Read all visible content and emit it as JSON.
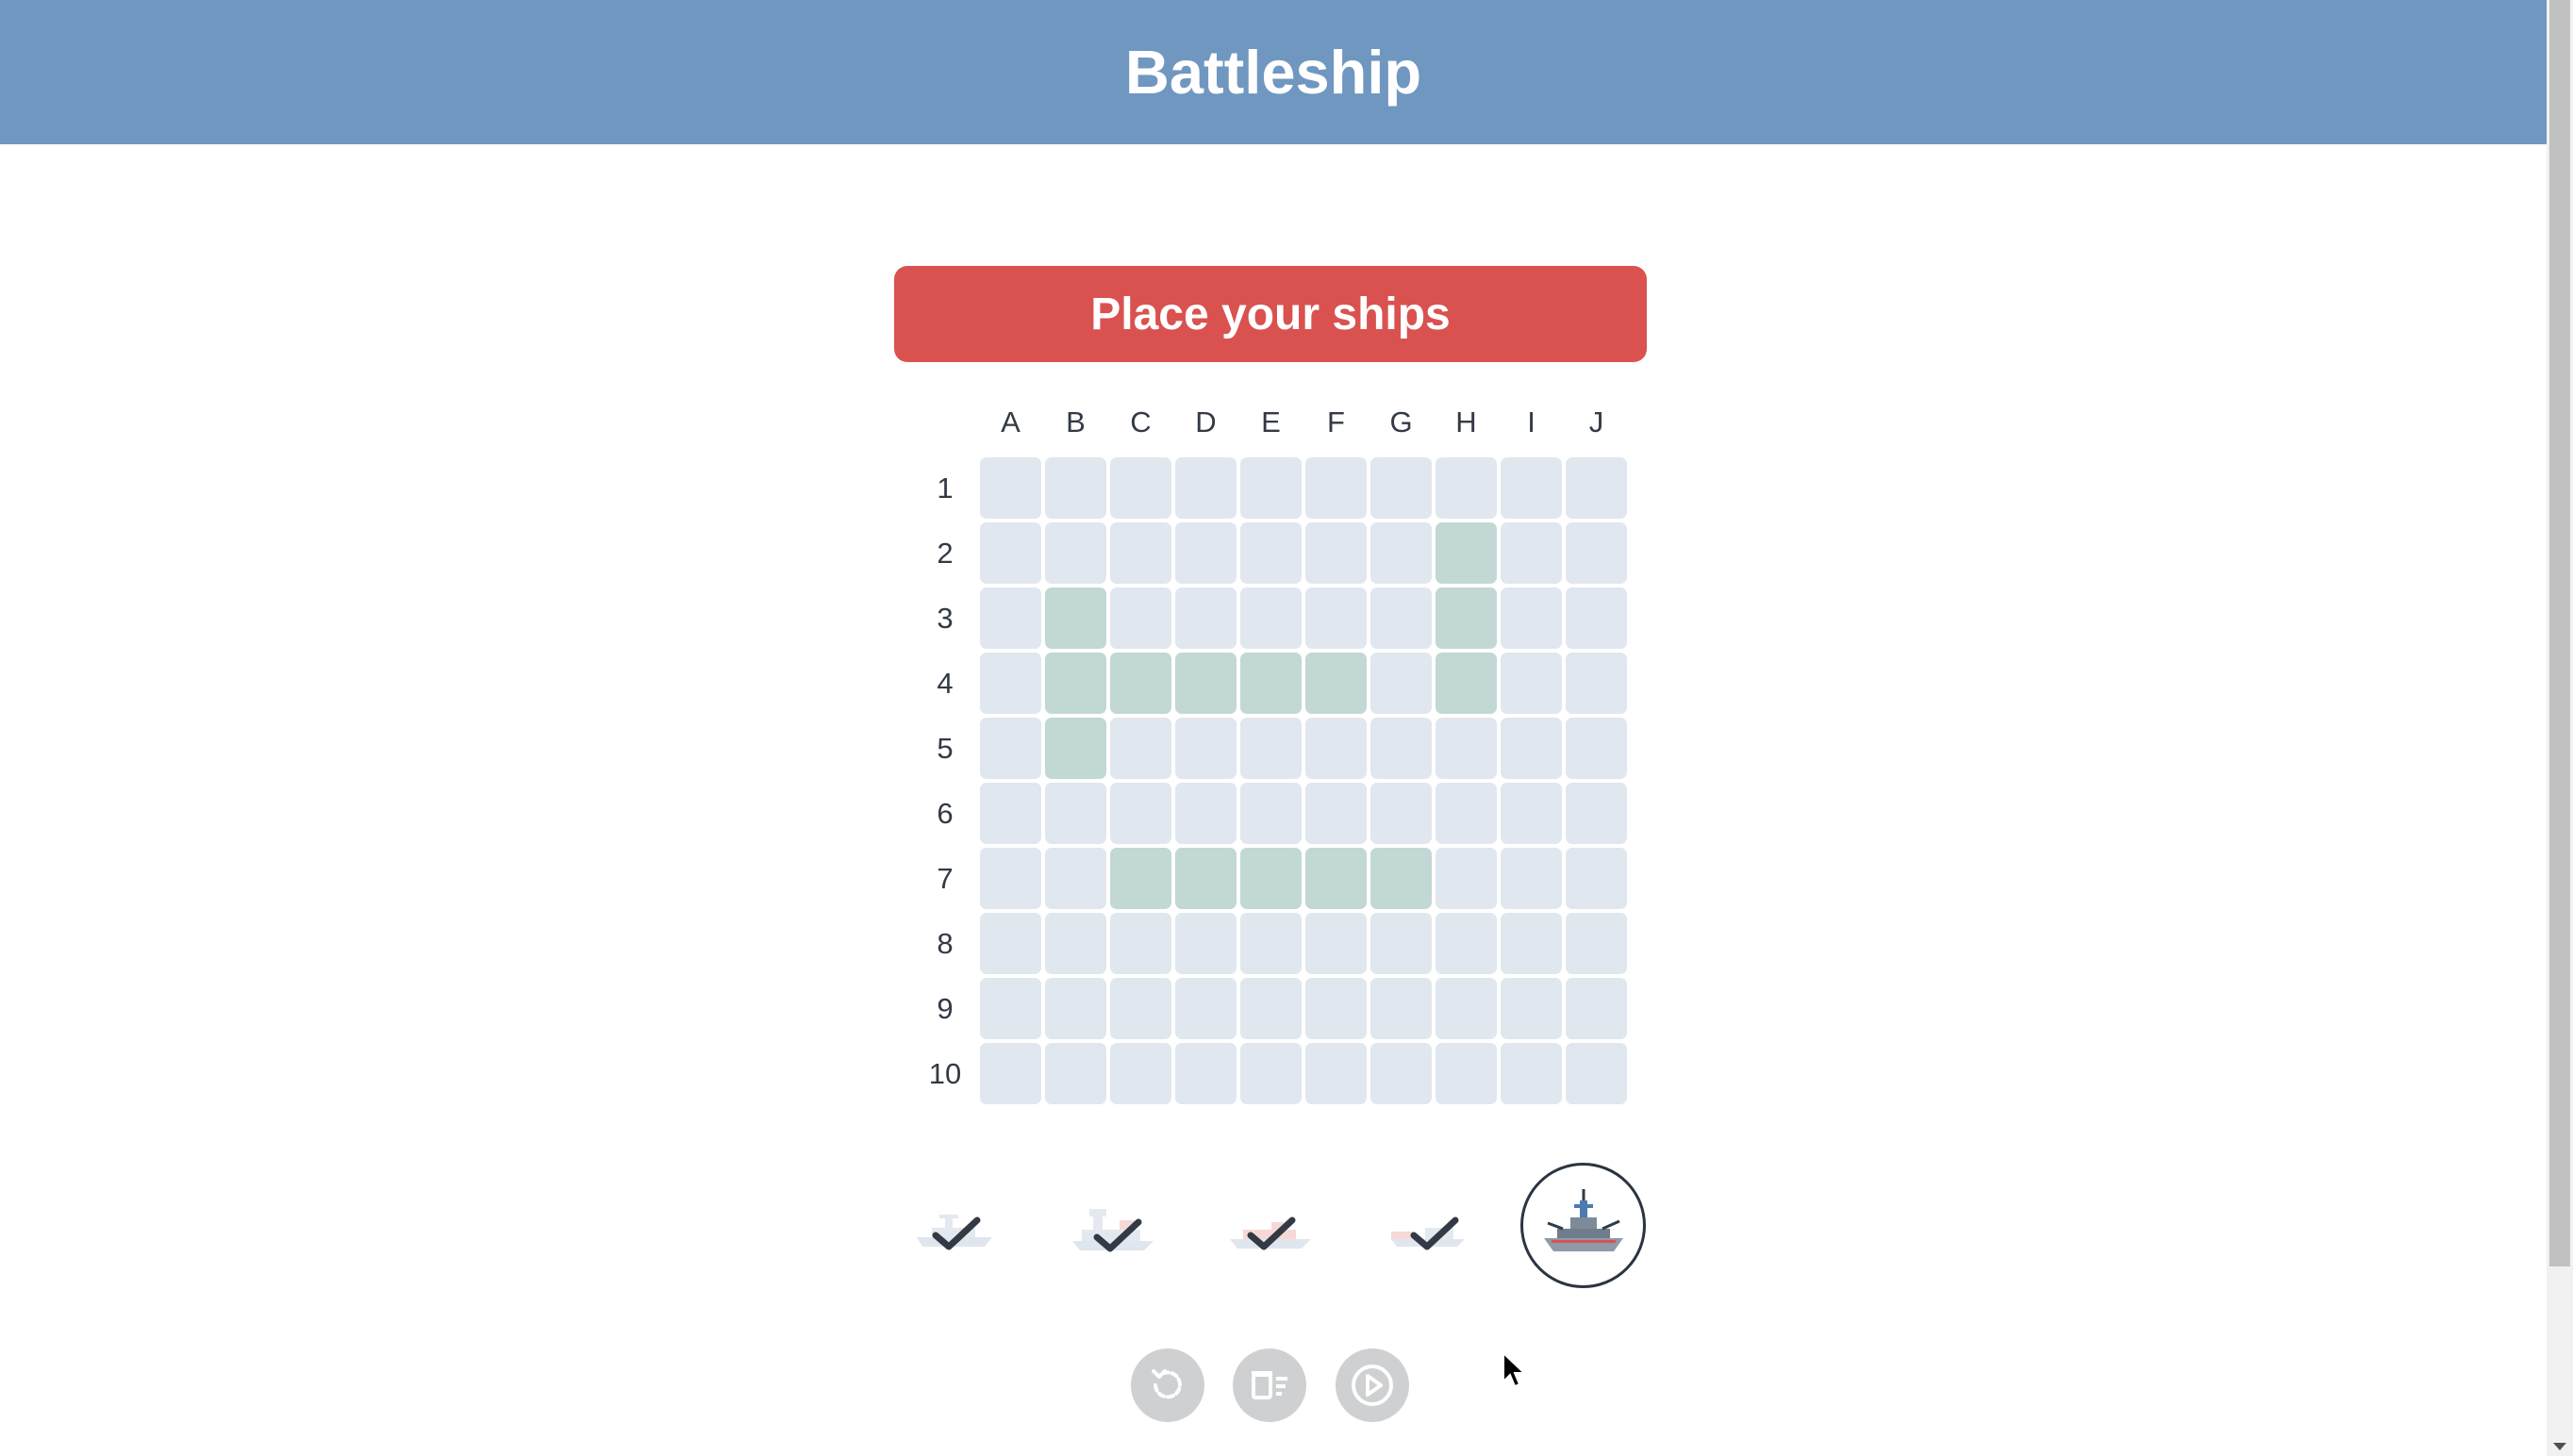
{
  "header": {
    "title": "Battleship"
  },
  "banner": {
    "text": "Place your ships"
  },
  "board": {
    "columns": [
      "A",
      "B",
      "C",
      "D",
      "E",
      "F",
      "G",
      "H",
      "I",
      "J"
    ],
    "rows": [
      "1",
      "2",
      "3",
      "4",
      "5",
      "6",
      "7",
      "8",
      "9",
      "10"
    ],
    "placed_cells": [
      "H2",
      "B3",
      "H3",
      "B4",
      "C4",
      "D4",
      "E4",
      "F4",
      "H4",
      "B5",
      "C7",
      "D7",
      "E7",
      "F7",
      "G7"
    ],
    "cell_color": "#e0e7ee",
    "ship_color": "#c1d8d4"
  },
  "ships": [
    {
      "name": "ship-1",
      "placed": true
    },
    {
      "name": "ship-2",
      "placed": true
    },
    {
      "name": "ship-3",
      "placed": true
    },
    {
      "name": "ship-4",
      "placed": true
    },
    {
      "name": "ship-5",
      "placed": false,
      "selected": true
    }
  ],
  "controls": [
    {
      "icon": "rotate-icon"
    },
    {
      "icon": "clear-board-icon"
    },
    {
      "icon": "play-icon"
    }
  ],
  "colors": {
    "header": "#7097c0",
    "banner": "#d95250",
    "text": "#333a45"
  }
}
